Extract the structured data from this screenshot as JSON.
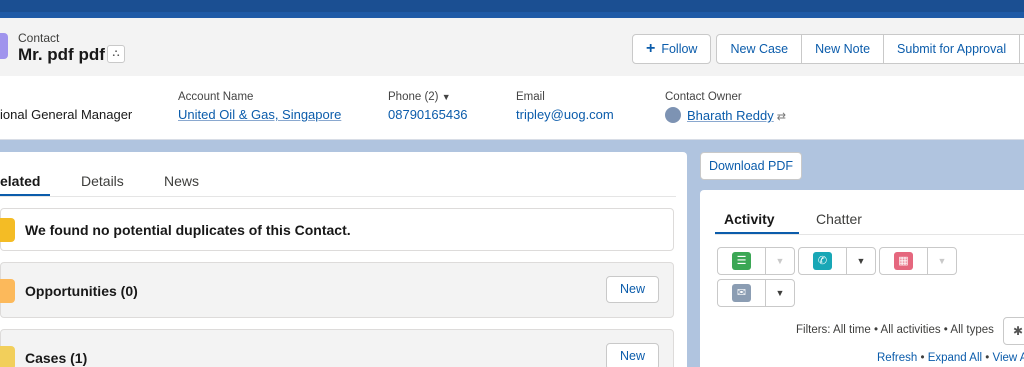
{
  "record": {
    "object_label": "Contact",
    "name": "Mr. pdf pdf",
    "hierarchy_glyph": "⛬"
  },
  "actions": {
    "follow_icon": "+",
    "follow": "Follow",
    "new_case": "New Case",
    "new_note": "New Note",
    "submit_for_approval": "Submit for Approval",
    "more_icon": "▼"
  },
  "highlights": {
    "title_value": "ional General Manager",
    "account_name_label": "Account Name",
    "account_name": "United Oil & Gas, Singapore",
    "phone_label": "Phone (2)",
    "phone_toggle": "▼",
    "phone": "08790165436",
    "email_label": "Email",
    "email": "tripley@uog.com",
    "owner_label": "Contact Owner",
    "owner": "Bharath Reddy",
    "owner_change_icon": "⇄"
  },
  "tabs": {
    "related": "elated",
    "details": "Details",
    "news": "News"
  },
  "related": {
    "duplicates_msg": "We found no potential duplicates of this Contact.",
    "opportunities": "Opportunities (0)",
    "opportunities_new": "New",
    "cases": "Cases (1)",
    "cases_new": "New"
  },
  "sidebar": {
    "download_pdf": "Download PDF",
    "activity_tab": "Activity",
    "chatter_tab": "Chatter",
    "dropdown_glyph": "▼",
    "filters_text": "Filters: All time • All activities • All types",
    "gear_glyph": "✱",
    "refresh": "Refresh",
    "sep": " • ",
    "expand_all": "Expand All",
    "view_all": "View A"
  },
  "colors": {
    "task": "#3ba755",
    "call": "#18a7b6",
    "event": "#e5677e",
    "email": "#8b9db3",
    "duplicates": "#f4bc25",
    "opportunities": "#fcb95b",
    "cases": "#f2cf5b",
    "brand": "#0b5cab"
  }
}
